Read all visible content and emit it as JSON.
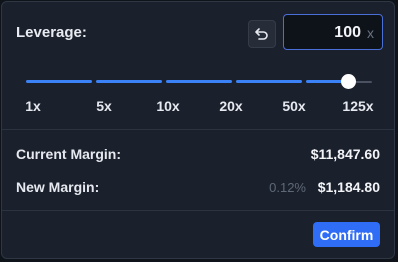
{
  "leverage": {
    "label": "Leverage:",
    "value": "100",
    "suffix": "x",
    "level_fraction": 0.93
  },
  "slider": {
    "marks": [
      "1x",
      "5x",
      "10x",
      "20x",
      "50x",
      "125x"
    ]
  },
  "margin": {
    "current_label": "Current Margin:",
    "current_value": "$11,847.60",
    "new_label": "New Margin:",
    "new_percent": "0.12%",
    "new_value": "$1,184.80"
  },
  "actions": {
    "confirm_label": "Confirm"
  },
  "icons": {
    "reset": "undo-arrow-icon"
  },
  "colors": {
    "accent": "#3b82f6",
    "button": "#2f6df6",
    "background": "#1b212c"
  }
}
